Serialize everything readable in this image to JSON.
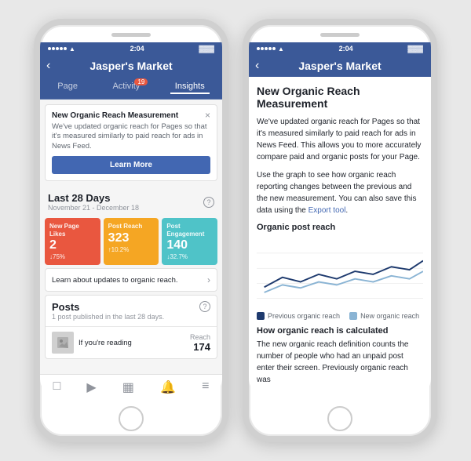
{
  "app": {
    "title": "Jasper's Market",
    "status_time": "2:04",
    "signal_bars": 5
  },
  "left_phone": {
    "tabs": [
      {
        "label": "Page",
        "active": false,
        "badge": null
      },
      {
        "label": "Activity",
        "active": false,
        "badge": "19"
      },
      {
        "label": "Insights",
        "active": true,
        "badge": null
      }
    ],
    "notification": {
      "title": "New Organic Reach Measurement",
      "text": "We've updated organic reach for Pages so that it's measured similarly to paid reach for ads in News Feed.",
      "button_label": "Learn More"
    },
    "stats_section": {
      "title": "Last 28 Days",
      "subtitle": "November 21 - December 18",
      "stats": [
        {
          "label": "New Page Likes",
          "value": "2",
          "change": "↓75%",
          "color": "red"
        },
        {
          "label": "Post Reach",
          "value": "323",
          "change": "↑10.2%",
          "color": "orange"
        },
        {
          "label": "Post Engagement",
          "value": "140",
          "change": "↓32.7%",
          "color": "teal"
        }
      ]
    },
    "organic_reach_link": "Learn about updates to organic reach.",
    "posts_section": {
      "title": "Posts",
      "subtitle": "1 post published in the last 28 days.",
      "post": {
        "text": "If you're reading",
        "reach_label": "Reach",
        "reach_value": "174"
      }
    },
    "bottom_nav_icons": [
      "▶",
      "🏠",
      "🔔",
      "≡"
    ]
  },
  "right_phone": {
    "detail_title": "New Organic Reach Measurement",
    "paragraphs": [
      "We've updated organic reach for Pages so that it's measured similarly to paid reach for ads in News Feed. This allows you to more accurately compare paid and organic posts for your Page.",
      "Use the graph to see how organic reach reporting changes between the previous and the new measurement. You can also save this data using the Export tool."
    ],
    "export_link_text": "Export tool",
    "chart": {
      "label": "Organic post reach",
      "series": [
        {
          "name": "Previous organic reach",
          "color": "#1e3a6e",
          "points": [
            20,
            35,
            28,
            40,
            32,
            45,
            38,
            50,
            42,
            55
          ]
        },
        {
          "name": "New organic reach",
          "color": "#8ab4d4",
          "points": [
            15,
            25,
            20,
            30,
            25,
            35,
            28,
            38,
            32,
            42
          ]
        }
      ]
    },
    "legend": [
      {
        "label": "Previous organic reach",
        "color": "#1e3a6e"
      },
      {
        "label": "New organic reach",
        "color": "#8ab4d4"
      }
    ],
    "how_section": {
      "title": "How organic reach is calculated",
      "text": "The new organic reach definition counts the number of people who had an unpaid post enter their screen. Previously organic reach was"
    }
  },
  "icons": {
    "back_arrow": "‹",
    "close_x": "×",
    "help": "?",
    "chevron_right": "›",
    "page_icon": "□",
    "video_icon": "▶",
    "calendar_icon": "📅",
    "bell_icon": "🔔",
    "menu_icon": "≡"
  }
}
